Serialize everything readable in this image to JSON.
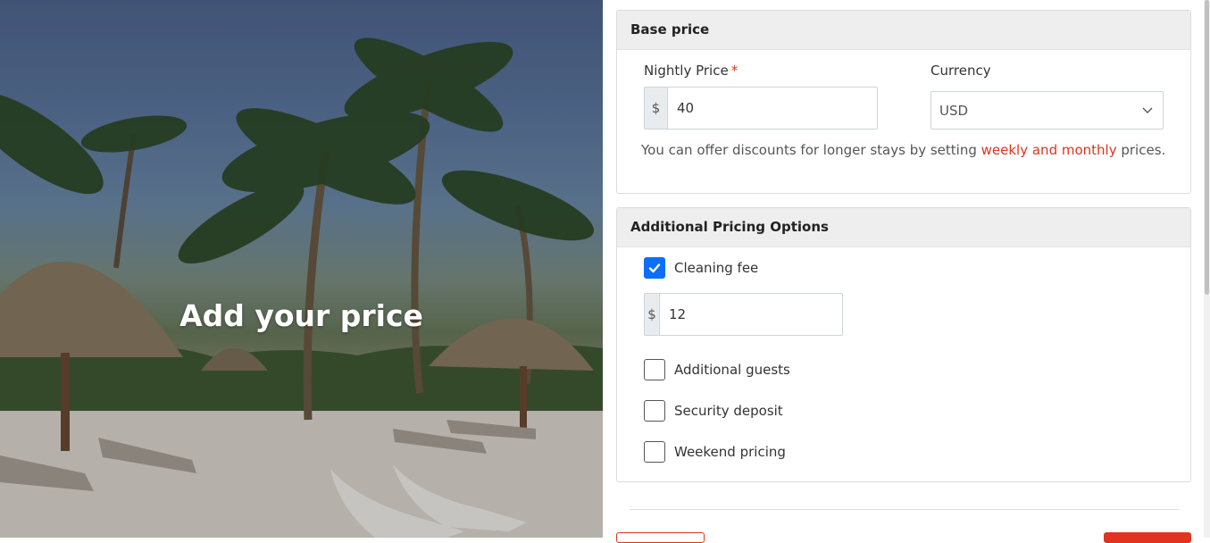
{
  "hero": {
    "title": "Add your price"
  },
  "base_price": {
    "heading": "Base price",
    "nightly_label": "Nightly Price",
    "required_mark": "*",
    "currency_symbol": "$",
    "nightly_value": "40",
    "currency_label": "Currency",
    "currency_value": "USD",
    "help_text_before": "You can offer discounts for longer stays by setting ",
    "help_link": "weekly and monthly",
    "help_text_after": " prices."
  },
  "additional": {
    "heading": "Additional Pricing Options",
    "cleaning_fee": {
      "label": "Cleaning fee",
      "checked": true,
      "currency_symbol": "$",
      "value": "12"
    },
    "options": [
      {
        "label": "Additional guests",
        "checked": false
      },
      {
        "label": "Security deposit",
        "checked": false
      },
      {
        "label": "Weekend pricing",
        "checked": false
      }
    ]
  },
  "colors": {
    "accent": "#e0341f",
    "checkbox": "#0b6efd",
    "panel_header": "#eeeeee"
  }
}
